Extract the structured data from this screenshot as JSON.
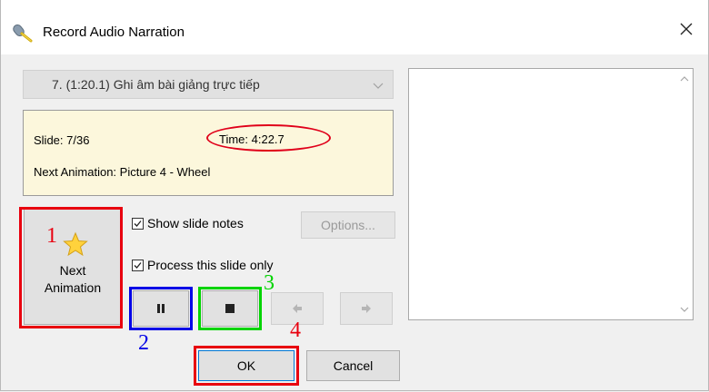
{
  "window": {
    "title": "Record Audio Narration"
  },
  "slide_select": {
    "value": "7. (1:20.1) Ghi âm bài giảng trực tiếp"
  },
  "info": {
    "slide": "Slide: 7/36",
    "time": "Time: 4:22.7",
    "next_animation": "Next Animation: Picture 4 - Wheel"
  },
  "next_animation_button": {
    "line1": "Next",
    "line2": "Animation"
  },
  "options": {
    "show_slide_notes": "Show slide notes",
    "show_slide_notes_checked": true,
    "process_this_slide_only": "Process this slide only",
    "process_this_slide_only_checked": true,
    "options_button": "Options..."
  },
  "buttons": {
    "ok": "OK",
    "cancel": "Cancel"
  },
  "annotations": {
    "n1": "1",
    "n2": "2",
    "n3": "3",
    "n4": "4",
    "red": "#e8000f",
    "blue": "#0000e6",
    "green": "#00d400"
  },
  "icons": {
    "title": "microphone-icon",
    "close": "close-icon",
    "dropdown": "chevron-down-icon",
    "star": "star-icon",
    "pause": "pause-icon",
    "stop": "stop-icon",
    "prev": "arrow-left-icon",
    "next": "arrow-right-icon"
  }
}
